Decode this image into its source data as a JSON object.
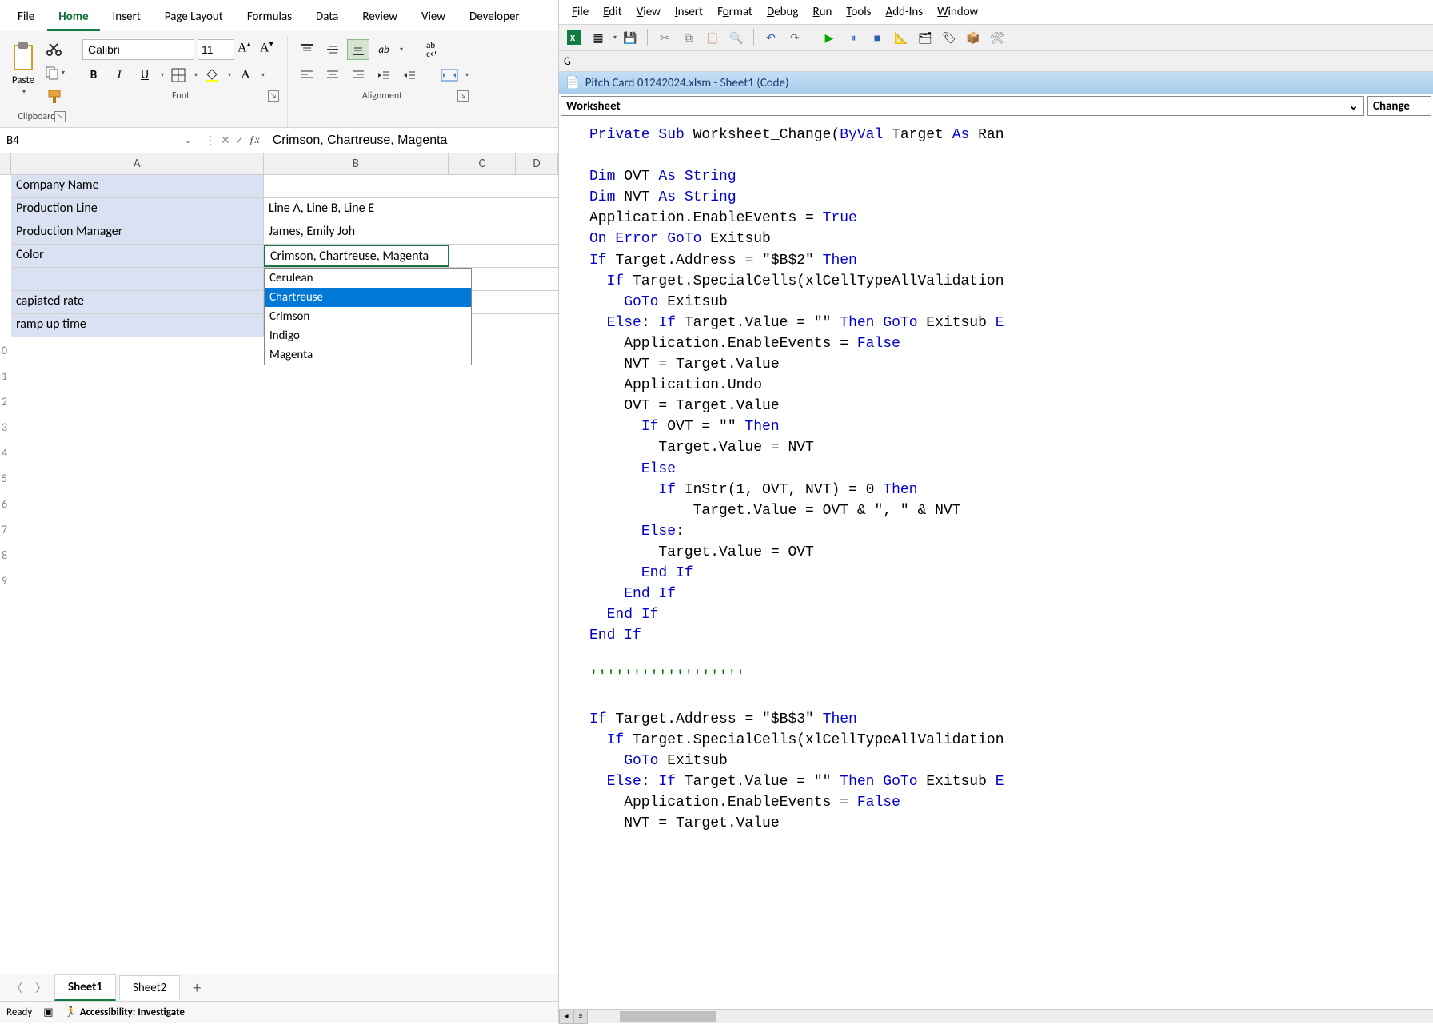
{
  "excel": {
    "tabs": [
      "File",
      "Home",
      "Insert",
      "Page Layout",
      "Formulas",
      "Data",
      "Review",
      "View",
      "Developer"
    ],
    "active_tab": "Home",
    "ribbon": {
      "clipboard": {
        "label": "Clipboard",
        "paste": "Paste"
      },
      "font": {
        "label": "Font",
        "name": "Calibri",
        "size": "11"
      },
      "alignment": {
        "label": "Alignment"
      }
    },
    "namebox": "B4",
    "formula": "Crimson, Chartreuse, Magenta",
    "columns": [
      "A",
      "B",
      "C",
      "D"
    ],
    "row_numbers": [
      "0",
      "1",
      "2",
      "3",
      "4",
      "5",
      "6",
      "7",
      "8",
      "9"
    ],
    "cells": {
      "A1": "Company Name",
      "A2": "Production Line",
      "A3": "Production Manager",
      "A4": "Color",
      "A6": "capiated rate",
      "A7": "ramp up time",
      "B2": "Line A, Line B, Line E",
      "B3": "James, Emily Joh",
      "B4": "Crimson, Chartreuse, Magenta"
    },
    "dropdown": {
      "items": [
        "Cerulean",
        "Chartreuse",
        "Crimson",
        "Indigo",
        "Magenta"
      ],
      "selected": "Chartreuse"
    },
    "sheets": {
      "active": "Sheet1",
      "other": "Sheet2"
    },
    "status": {
      "ready": "Ready",
      "access": "Accessibility: Investigate"
    }
  },
  "vbe": {
    "menu": [
      "File",
      "Edit",
      "View",
      "Insert",
      "Format",
      "Debug",
      "Run",
      "Tools",
      "Add-Ins",
      "Window"
    ],
    "title": "Pitch Card 01242024.xlsm - Sheet1 (Code)",
    "sel_left": "Worksheet",
    "sel_right": "Change",
    "code_lines": [
      {
        "t": "kw",
        "s": "Private Sub"
      },
      {
        "t": "p",
        "s": " Worksheet_Change("
      },
      {
        "t": "kw",
        "s": "ByVal"
      },
      {
        "t": "p",
        "s": " Target "
      },
      {
        "t": "kw",
        "s": "As"
      },
      {
        "t": "p",
        "s": " Ran"
      }
    ]
  }
}
